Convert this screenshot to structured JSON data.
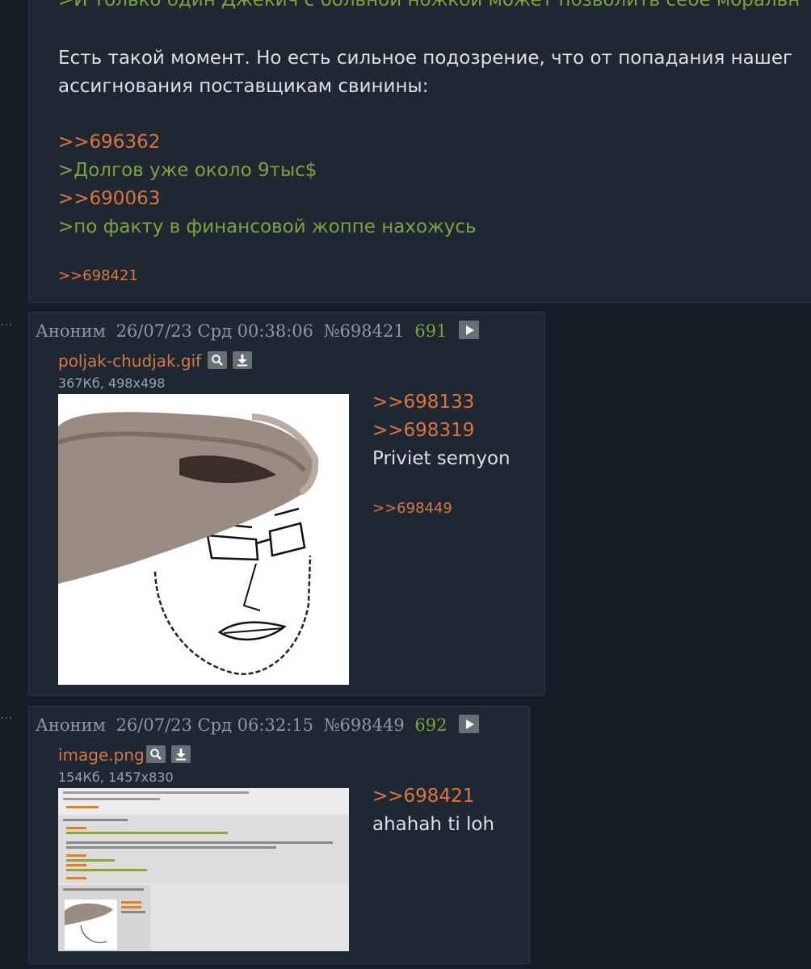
{
  "thread": {
    "post_prev": {
      "lines": [
        {
          "type": "greentext",
          "text": ">И только один Джекич с больной ножкой может позволить себе моральн"
        },
        {
          "type": "body",
          "text": "Есть такой момент. Но есть сильное подозрение, что от попадания нашег"
        },
        {
          "type": "body",
          "text": "ассигнования поставщикам свинины:"
        },
        {
          "type": "reflink",
          "text": ">>696362"
        },
        {
          "type": "greentext",
          "text": ">Долгов уже около 9тыс$"
        },
        {
          "type": "reflink",
          "text": ">>690063"
        },
        {
          "type": "greentext",
          "text": ">по факту в финансовой жоппе нахожусь"
        }
      ],
      "replies": [
        ">>698421"
      ]
    },
    "post_698421": {
      "menu_icon": "ellipsis-icon",
      "author": "Аноним",
      "date": "26/07/23 Срд 00:38:06",
      "number": "№698421",
      "count": "691",
      "file": {
        "name": "poljak-chudjak.gif",
        "meta": "367Кб, 498x498",
        "search_icon": "search-icon",
        "download_icon": "download-icon"
      },
      "message": [
        {
          "type": "reflink",
          "text": ">>698133"
        },
        {
          "type": "reflink",
          "text": ">>698319"
        },
        {
          "type": "body",
          "text": "Priviet semyon"
        }
      ],
      "replies": [
        ">>698449"
      ]
    },
    "post_698449": {
      "menu_icon": "ellipsis-icon",
      "author": "Аноним",
      "date": "26/07/23 Срд 06:32:15",
      "number": "№698449",
      "count": "692",
      "file": {
        "name": "image.png",
        "meta": "154Кб, 1457x830",
        "search_icon": "search-icon",
        "download_icon": "download-icon"
      },
      "message": [
        {
          "type": "reflink",
          "text": ">>698421"
        },
        {
          "type": "body",
          "text": "ahahah ti loh"
        }
      ]
    }
  },
  "colors": {
    "background": "#161d27",
    "post_bg": "#1f2733",
    "reflink": "#d9763f",
    "greentext": "#7ca33c",
    "text": "#dddfe2",
    "meta": "#8f969f"
  }
}
